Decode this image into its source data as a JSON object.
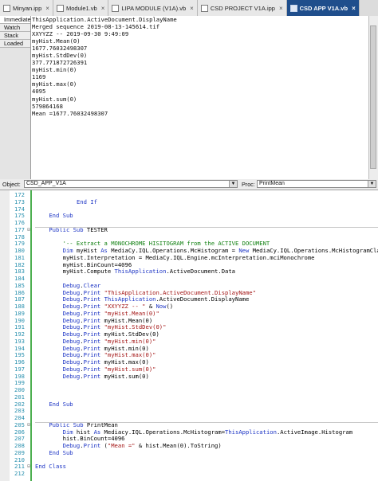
{
  "tabs": [
    {
      "label": "Minyan.ipp",
      "active": false
    },
    {
      "label": "Module1.vb",
      "active": false
    },
    {
      "label": "LIPA MODULE (V1A).vb",
      "active": false
    },
    {
      "label": "CSD PROJECT V1A.ipp",
      "active": false
    },
    {
      "label": "CSD APP V1A.vb",
      "active": true
    }
  ],
  "debug_tabs": [
    "Immediate",
    "Watch",
    "Stack",
    "Loaded"
  ],
  "output_lines": [
    "ThisApplication.ActiveDocument.DisplayName",
    "Merged sequence 2019-08-13-145614.tif",
    "XXYYZZ -- 2019-09-30 9:49:09",
    "myHist.Mean(0)",
    "1677.76032498307",
    "myHist.StdDev(0)",
    "377.771872726391",
    "myHist.min(0)",
    "1169",
    "myHist.max(0)",
    "4095",
    "myHist.sum(0)",
    "579864168",
    "Mean =1677.76032498307"
  ],
  "object_bar": {
    "object_label": "Object:",
    "object_value": "CSD_APP_V1A",
    "proc_label": "Proc:",
    "proc_value": "PrintMean"
  },
  "code_lines": [
    {
      "n": "172",
      "fold": "",
      "parts": [
        {
          "t": ""
        }
      ]
    },
    {
      "n": "173",
      "fold": "",
      "parts": [
        {
          "t": "            "
        },
        {
          "t": "End If",
          "c": "kw"
        }
      ]
    },
    {
      "n": "174",
      "fold": "",
      "parts": [
        {
          "t": ""
        }
      ]
    },
    {
      "n": "175",
      "fold": "",
      "parts": [
        {
          "t": "    "
        },
        {
          "t": "End Sub",
          "c": "kw"
        }
      ]
    },
    {
      "n": "176",
      "fold": "",
      "parts": [
        {
          "t": ""
        }
      ]
    },
    {
      "n": "177",
      "fold": "⊟",
      "parts": [
        {
          "t": "    "
        },
        {
          "t": "Public Sub",
          "c": "kw"
        },
        {
          "t": " TESTER"
        }
      ]
    },
    {
      "n": "178",
      "fold": "",
      "parts": [
        {
          "t": ""
        }
      ]
    },
    {
      "n": "179",
      "fold": "",
      "parts": [
        {
          "t": "        "
        },
        {
          "t": "'-- Extract a MONOCHROME HISITOGRAM from the ACTIVE DOCUMENT",
          "c": "cmt"
        }
      ]
    },
    {
      "n": "180",
      "fold": "",
      "parts": [
        {
          "t": "        "
        },
        {
          "t": "Dim",
          "c": "kw"
        },
        {
          "t": " myHist "
        },
        {
          "t": "As",
          "c": "kw"
        },
        {
          "t": " MediaCy.IQL.Operations.McHistogram = "
        },
        {
          "t": "New",
          "c": "kw"
        },
        {
          "t": " MediaCy.IQL.Operations.McHistogramClass"
        }
      ]
    },
    {
      "n": "181",
      "fold": "",
      "parts": [
        {
          "t": "        myHist.Interpretation = MediaCy.IQL.Engine.mcInterpretation.mciMonochrome"
        }
      ]
    },
    {
      "n": "182",
      "fold": "",
      "parts": [
        {
          "t": "        myHist.BinCount=4096"
        }
      ]
    },
    {
      "n": "183",
      "fold": "",
      "parts": [
        {
          "t": "        myHist.Compute "
        },
        {
          "t": "ThisApplication",
          "c": "blue"
        },
        {
          "t": ".ActiveDocument.Data"
        }
      ]
    },
    {
      "n": "184",
      "fold": "",
      "parts": [
        {
          "t": ""
        }
      ]
    },
    {
      "n": "185",
      "fold": "",
      "parts": [
        {
          "t": "        "
        },
        {
          "t": "Debug",
          "c": "blue"
        },
        {
          "t": "."
        },
        {
          "t": "Clear",
          "c": "blue"
        }
      ]
    },
    {
      "n": "186",
      "fold": "",
      "parts": [
        {
          "t": "        "
        },
        {
          "t": "Debug",
          "c": "blue"
        },
        {
          "t": "."
        },
        {
          "t": "Print",
          "c": "blue"
        },
        {
          "t": " "
        },
        {
          "t": "\"ThisApplication.ActiveDocument.DisplayName\"",
          "c": "str"
        }
      ]
    },
    {
      "n": "187",
      "fold": "",
      "parts": [
        {
          "t": "        "
        },
        {
          "t": "Debug",
          "c": "blue"
        },
        {
          "t": "."
        },
        {
          "t": "Print",
          "c": "blue"
        },
        {
          "t": " "
        },
        {
          "t": "ThisApplication",
          "c": "blue"
        },
        {
          "t": ".ActiveDocument.DisplayName"
        }
      ]
    },
    {
      "n": "188",
      "fold": "",
      "parts": [
        {
          "t": "        "
        },
        {
          "t": "Debug",
          "c": "blue"
        },
        {
          "t": "."
        },
        {
          "t": "Print",
          "c": "blue"
        },
        {
          "t": " "
        },
        {
          "t": "\"XXYYZZ -- \"",
          "c": "str"
        },
        {
          "t": " & "
        },
        {
          "t": "Now",
          "c": "blue"
        },
        {
          "t": "()"
        }
      ]
    },
    {
      "n": "189",
      "fold": "",
      "parts": [
        {
          "t": "        "
        },
        {
          "t": "Debug",
          "c": "blue"
        },
        {
          "t": "."
        },
        {
          "t": "Print",
          "c": "blue"
        },
        {
          "t": " "
        },
        {
          "t": "\"myHist.Mean(0)\"",
          "c": "str"
        }
      ]
    },
    {
      "n": "190",
      "fold": "",
      "parts": [
        {
          "t": "        "
        },
        {
          "t": "Debug",
          "c": "blue"
        },
        {
          "t": "."
        },
        {
          "t": "Print",
          "c": "blue"
        },
        {
          "t": " myHist.Mean(0)"
        }
      ]
    },
    {
      "n": "191",
      "fold": "",
      "parts": [
        {
          "t": "        "
        },
        {
          "t": "Debug",
          "c": "blue"
        },
        {
          "t": "."
        },
        {
          "t": "Print",
          "c": "blue"
        },
        {
          "t": " "
        },
        {
          "t": "\"myHist.StdDev(0)\"",
          "c": "str"
        }
      ]
    },
    {
      "n": "192",
      "fold": "",
      "parts": [
        {
          "t": "        "
        },
        {
          "t": "Debug",
          "c": "blue"
        },
        {
          "t": "."
        },
        {
          "t": "Print",
          "c": "blue"
        },
        {
          "t": " myHist.StdDev(0)"
        }
      ]
    },
    {
      "n": "193",
      "fold": "",
      "parts": [
        {
          "t": "        "
        },
        {
          "t": "Debug",
          "c": "blue"
        },
        {
          "t": "."
        },
        {
          "t": "Print",
          "c": "blue"
        },
        {
          "t": " "
        },
        {
          "t": "\"myHist.min(0)\"",
          "c": "str"
        }
      ]
    },
    {
      "n": "194",
      "fold": "",
      "parts": [
        {
          "t": "        "
        },
        {
          "t": "Debug",
          "c": "blue"
        },
        {
          "t": "."
        },
        {
          "t": "Print",
          "c": "blue"
        },
        {
          "t": " myHist.min(0)"
        }
      ]
    },
    {
      "n": "195",
      "fold": "",
      "parts": [
        {
          "t": "        "
        },
        {
          "t": "Debug",
          "c": "blue"
        },
        {
          "t": "."
        },
        {
          "t": "Print",
          "c": "blue"
        },
        {
          "t": " "
        },
        {
          "t": "\"myHist.max(0)\"",
          "c": "str"
        }
      ]
    },
    {
      "n": "196",
      "fold": "",
      "parts": [
        {
          "t": "        "
        },
        {
          "t": "Debug",
          "c": "blue"
        },
        {
          "t": "."
        },
        {
          "t": "Print",
          "c": "blue"
        },
        {
          "t": " myHist.max(0)"
        }
      ]
    },
    {
      "n": "197",
      "fold": "",
      "parts": [
        {
          "t": "        "
        },
        {
          "t": "Debug",
          "c": "blue"
        },
        {
          "t": "."
        },
        {
          "t": "Print",
          "c": "blue"
        },
        {
          "t": " "
        },
        {
          "t": "\"myHist.sum(0)\"",
          "c": "str"
        }
      ]
    },
    {
      "n": "198",
      "fold": "",
      "parts": [
        {
          "t": "        "
        },
        {
          "t": "Debug",
          "c": "blue"
        },
        {
          "t": "."
        },
        {
          "t": "Print",
          "c": "blue"
        },
        {
          "t": " myHist.sum(0)"
        }
      ]
    },
    {
      "n": "199",
      "fold": "",
      "parts": [
        {
          "t": ""
        }
      ]
    },
    {
      "n": "200",
      "fold": "",
      "parts": [
        {
          "t": ""
        }
      ]
    },
    {
      "n": "201",
      "fold": "",
      "parts": [
        {
          "t": ""
        }
      ]
    },
    {
      "n": "202",
      "fold": "",
      "parts": [
        {
          "t": "    "
        },
        {
          "t": "End Sub",
          "c": "kw"
        }
      ]
    },
    {
      "n": "203",
      "fold": "",
      "parts": [
        {
          "t": ""
        }
      ]
    },
    {
      "n": "204",
      "fold": "",
      "parts": [
        {
          "t": ""
        }
      ]
    },
    {
      "n": "205",
      "fold": "⊟",
      "parts": [
        {
          "t": "    "
        },
        {
          "t": "Public Sub",
          "c": "kw"
        },
        {
          "t": " PrintMean"
        }
      ]
    },
    {
      "n": "206",
      "fold": "",
      "parts": [
        {
          "t": "        "
        },
        {
          "t": "Dim",
          "c": "kw"
        },
        {
          "t": " hist "
        },
        {
          "t": "As",
          "c": "kw"
        },
        {
          "t": " Mediacy.IQL.Operations.McHistogram="
        },
        {
          "t": "ThisApplication",
          "c": "blue"
        },
        {
          "t": ".ActiveImage.Histogram"
        }
      ]
    },
    {
      "n": "207",
      "fold": "",
      "parts": [
        {
          "t": "        hist.BinCount=4096"
        }
      ]
    },
    {
      "n": "208",
      "fold": "",
      "parts": [
        {
          "t": "        "
        },
        {
          "t": "Debug",
          "c": "blue"
        },
        {
          "t": "."
        },
        {
          "t": "Print",
          "c": "blue"
        },
        {
          "t": " ("
        },
        {
          "t": "\"Mean =\"",
          "c": "str"
        },
        {
          "t": " & hist.Mean(0).ToString)"
        }
      ]
    },
    {
      "n": "209",
      "fold": "",
      "parts": [
        {
          "t": "    "
        },
        {
          "t": "End Sub",
          "c": "kw"
        }
      ]
    },
    {
      "n": "210",
      "fold": "",
      "parts": [
        {
          "t": ""
        }
      ]
    },
    {
      "n": "211",
      "fold": "⊟",
      "parts": [
        {
          "t": "End Class",
          "c": "kw"
        }
      ]
    },
    {
      "n": "212",
      "fold": "",
      "parts": [
        {
          "t": ""
        }
      ]
    }
  ]
}
